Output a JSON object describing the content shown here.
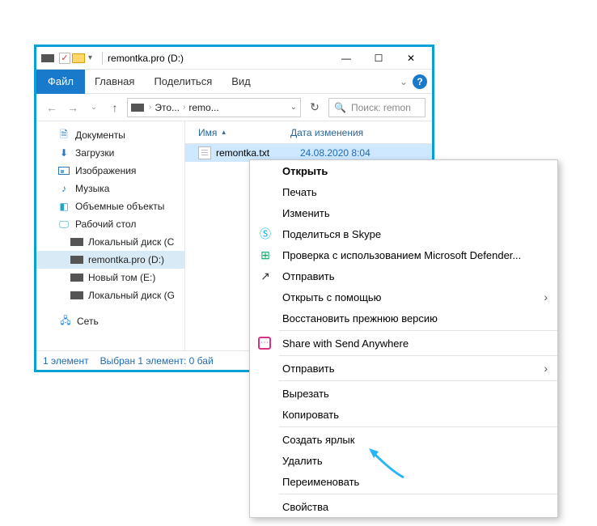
{
  "titlebar": {
    "title": "remontka.pro (D:)"
  },
  "ribbon": {
    "file": "Файл",
    "home": "Главная",
    "share": "Поделиться",
    "view": "Вид"
  },
  "address": {
    "crumb1": "Это...",
    "crumb2": "remo..."
  },
  "search": {
    "placeholder": "Поиск: remon"
  },
  "sidebar": {
    "docs": "Документы",
    "downloads": "Загрузки",
    "pictures": "Изображения",
    "music": "Музыка",
    "objects3d": "Объемные объекты",
    "desktop": "Рабочий стол",
    "localC": "Локальный диск (C",
    "remontka": "remontka.pro (D:)",
    "newvol": "Новый том (E:)",
    "localG": "Локальный диск (G",
    "network": "Сеть"
  },
  "columns": {
    "name": "Имя",
    "date": "Дата изменения"
  },
  "file": {
    "name": "remontka.txt",
    "date": "24.08.2020 8:04"
  },
  "status": {
    "count": "1 элемент",
    "selected": "Выбран 1 элемент: 0 бай"
  },
  "context": {
    "open": "Открыть",
    "print": "Печать",
    "edit": "Изменить",
    "skype": "Поделиться в Skype",
    "defender": "Проверка с использованием Microsoft Defender...",
    "share": "Отправить",
    "openwith": "Открыть с помощью",
    "restore": "Восстановить прежнюю версию",
    "sendanywhere": "Share with Send Anywhere",
    "sendto": "Отправить",
    "cut": "Вырезать",
    "copy": "Копировать",
    "shortcut": "Создать ярлык",
    "delete": "Удалить",
    "rename": "Переименовать",
    "properties": "Свойства"
  }
}
